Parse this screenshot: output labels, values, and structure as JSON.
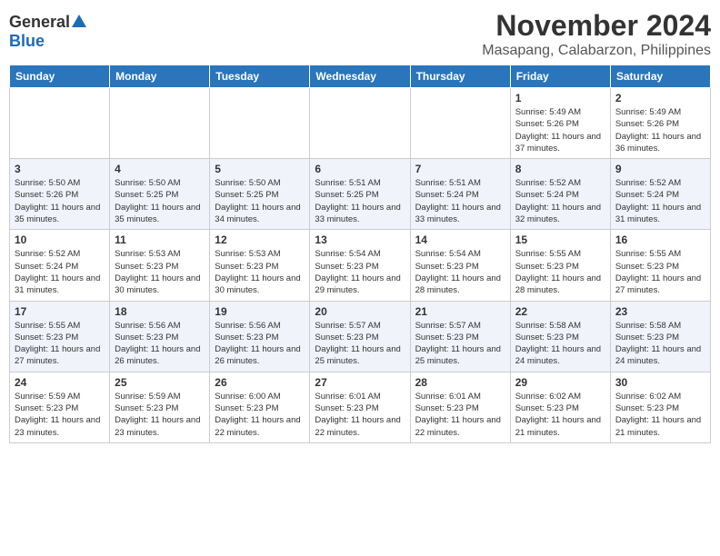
{
  "header": {
    "logo_general": "General",
    "logo_blue": "Blue",
    "title": "November 2024",
    "subtitle": "Masapang, Calabarzon, Philippines"
  },
  "days_of_week": [
    "Sunday",
    "Monday",
    "Tuesday",
    "Wednesday",
    "Thursday",
    "Friday",
    "Saturday"
  ],
  "weeks": [
    {
      "row_class": "week-row-1",
      "days": [
        {
          "date": "",
          "empty": true
        },
        {
          "date": "",
          "empty": true
        },
        {
          "date": "",
          "empty": true
        },
        {
          "date": "",
          "empty": true
        },
        {
          "date": "",
          "empty": true
        },
        {
          "date": "1",
          "sunrise": "Sunrise: 5:49 AM",
          "sunset": "Sunset: 5:26 PM",
          "daylight": "Daylight: 11 hours and 37 minutes."
        },
        {
          "date": "2",
          "sunrise": "Sunrise: 5:49 AM",
          "sunset": "Sunset: 5:26 PM",
          "daylight": "Daylight: 11 hours and 36 minutes."
        }
      ]
    },
    {
      "row_class": "week-row-2",
      "days": [
        {
          "date": "3",
          "sunrise": "Sunrise: 5:50 AM",
          "sunset": "Sunset: 5:26 PM",
          "daylight": "Daylight: 11 hours and 35 minutes."
        },
        {
          "date": "4",
          "sunrise": "Sunrise: 5:50 AM",
          "sunset": "Sunset: 5:25 PM",
          "daylight": "Daylight: 11 hours and 35 minutes."
        },
        {
          "date": "5",
          "sunrise": "Sunrise: 5:50 AM",
          "sunset": "Sunset: 5:25 PM",
          "daylight": "Daylight: 11 hours and 34 minutes."
        },
        {
          "date": "6",
          "sunrise": "Sunrise: 5:51 AM",
          "sunset": "Sunset: 5:25 PM",
          "daylight": "Daylight: 11 hours and 33 minutes."
        },
        {
          "date": "7",
          "sunrise": "Sunrise: 5:51 AM",
          "sunset": "Sunset: 5:24 PM",
          "daylight": "Daylight: 11 hours and 33 minutes."
        },
        {
          "date": "8",
          "sunrise": "Sunrise: 5:52 AM",
          "sunset": "Sunset: 5:24 PM",
          "daylight": "Daylight: 11 hours and 32 minutes."
        },
        {
          "date": "9",
          "sunrise": "Sunrise: 5:52 AM",
          "sunset": "Sunset: 5:24 PM",
          "daylight": "Daylight: 11 hours and 31 minutes."
        }
      ]
    },
    {
      "row_class": "week-row-3",
      "days": [
        {
          "date": "10",
          "sunrise": "Sunrise: 5:52 AM",
          "sunset": "Sunset: 5:24 PM",
          "daylight": "Daylight: 11 hours and 31 minutes."
        },
        {
          "date": "11",
          "sunrise": "Sunrise: 5:53 AM",
          "sunset": "Sunset: 5:23 PM",
          "daylight": "Daylight: 11 hours and 30 minutes."
        },
        {
          "date": "12",
          "sunrise": "Sunrise: 5:53 AM",
          "sunset": "Sunset: 5:23 PM",
          "daylight": "Daylight: 11 hours and 30 minutes."
        },
        {
          "date": "13",
          "sunrise": "Sunrise: 5:54 AM",
          "sunset": "Sunset: 5:23 PM",
          "daylight": "Daylight: 11 hours and 29 minutes."
        },
        {
          "date": "14",
          "sunrise": "Sunrise: 5:54 AM",
          "sunset": "Sunset: 5:23 PM",
          "daylight": "Daylight: 11 hours and 28 minutes."
        },
        {
          "date": "15",
          "sunrise": "Sunrise: 5:55 AM",
          "sunset": "Sunset: 5:23 PM",
          "daylight": "Daylight: 11 hours and 28 minutes."
        },
        {
          "date": "16",
          "sunrise": "Sunrise: 5:55 AM",
          "sunset": "Sunset: 5:23 PM",
          "daylight": "Daylight: 11 hours and 27 minutes."
        }
      ]
    },
    {
      "row_class": "week-row-4",
      "days": [
        {
          "date": "17",
          "sunrise": "Sunrise: 5:55 AM",
          "sunset": "Sunset: 5:23 PM",
          "daylight": "Daylight: 11 hours and 27 minutes."
        },
        {
          "date": "18",
          "sunrise": "Sunrise: 5:56 AM",
          "sunset": "Sunset: 5:23 PM",
          "daylight": "Daylight: 11 hours and 26 minutes."
        },
        {
          "date": "19",
          "sunrise": "Sunrise: 5:56 AM",
          "sunset": "Sunset: 5:23 PM",
          "daylight": "Daylight: 11 hours and 26 minutes."
        },
        {
          "date": "20",
          "sunrise": "Sunrise: 5:57 AM",
          "sunset": "Sunset: 5:23 PM",
          "daylight": "Daylight: 11 hours and 25 minutes."
        },
        {
          "date": "21",
          "sunrise": "Sunrise: 5:57 AM",
          "sunset": "Sunset: 5:23 PM",
          "daylight": "Daylight: 11 hours and 25 minutes."
        },
        {
          "date": "22",
          "sunrise": "Sunrise: 5:58 AM",
          "sunset": "Sunset: 5:23 PM",
          "daylight": "Daylight: 11 hours and 24 minutes."
        },
        {
          "date": "23",
          "sunrise": "Sunrise: 5:58 AM",
          "sunset": "Sunset: 5:23 PM",
          "daylight": "Daylight: 11 hours and 24 minutes."
        }
      ]
    },
    {
      "row_class": "week-row-5",
      "days": [
        {
          "date": "24",
          "sunrise": "Sunrise: 5:59 AM",
          "sunset": "Sunset: 5:23 PM",
          "daylight": "Daylight: 11 hours and 23 minutes."
        },
        {
          "date": "25",
          "sunrise": "Sunrise: 5:59 AM",
          "sunset": "Sunset: 5:23 PM",
          "daylight": "Daylight: 11 hours and 23 minutes."
        },
        {
          "date": "26",
          "sunrise": "Sunrise: 6:00 AM",
          "sunset": "Sunset: 5:23 PM",
          "daylight": "Daylight: 11 hours and 22 minutes."
        },
        {
          "date": "27",
          "sunrise": "Sunrise: 6:01 AM",
          "sunset": "Sunset: 5:23 PM",
          "daylight": "Daylight: 11 hours and 22 minutes."
        },
        {
          "date": "28",
          "sunrise": "Sunrise: 6:01 AM",
          "sunset": "Sunset: 5:23 PM",
          "daylight": "Daylight: 11 hours and 22 minutes."
        },
        {
          "date": "29",
          "sunrise": "Sunrise: 6:02 AM",
          "sunset": "Sunset: 5:23 PM",
          "daylight": "Daylight: 11 hours and 21 minutes."
        },
        {
          "date": "30",
          "sunrise": "Sunrise: 6:02 AM",
          "sunset": "Sunset: 5:23 PM",
          "daylight": "Daylight: 11 hours and 21 minutes."
        }
      ]
    }
  ]
}
